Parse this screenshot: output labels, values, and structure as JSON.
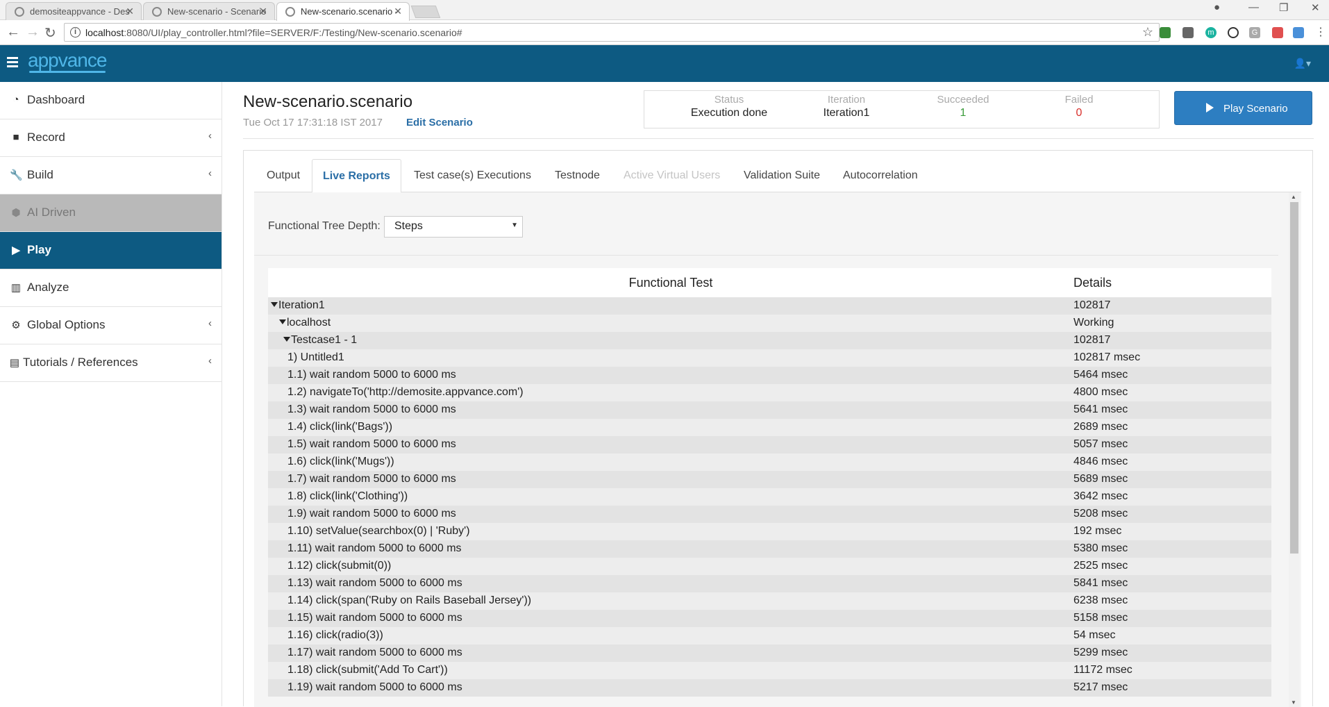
{
  "browser": {
    "tabs": [
      {
        "title": "demositeappvance - Des"
      },
      {
        "title": "New-scenario - Scenario"
      },
      {
        "title": "New-scenario.scenario -"
      }
    ],
    "url_prefix": "localhost",
    "url_rest": ":8080/UI/play_controller.html?file=SERVER/F:/Testing/New-scenario.scenario#"
  },
  "app": {
    "logo": "appvance",
    "brand_color": "#0d5a82"
  },
  "sidebar": {
    "items": [
      {
        "label": "Dashboard",
        "icon": "dashboard-icon"
      },
      {
        "label": "Record",
        "icon": "video-camera-icon"
      },
      {
        "label": "Build",
        "icon": "wrench-icon"
      },
      {
        "label": "AI Driven",
        "icon": "cubes-icon"
      },
      {
        "label": "Play",
        "icon": "play-icon"
      },
      {
        "label": "Analyze",
        "icon": "bar-chart-icon"
      },
      {
        "label": "Global Options",
        "icon": "cogs-icon"
      },
      {
        "label": "Tutorials / References",
        "icon": "book-icon"
      }
    ]
  },
  "header": {
    "title": "New-scenario.scenario",
    "timestamp": "Tue Oct 17 17:31:18 IST 2017",
    "edit_link": "Edit Scenario",
    "status": {
      "status_label": "Status",
      "status_value": "Execution done",
      "iteration_label": "Iteration",
      "iteration_value": "Iteration1",
      "succeeded_label": "Succeeded",
      "succeeded_value": "1",
      "failed_label": "Failed",
      "failed_value": "0"
    },
    "play_button": "Play Scenario"
  },
  "tabs": [
    "Output",
    "Live Reports",
    "Test case(s) Executions",
    "Testnode",
    "Active Virtual Users",
    "Validation Suite",
    "Autocorrelation"
  ],
  "report": {
    "depth_label": "Functional Tree Depth:",
    "depth_value": "Steps",
    "col_test": "Functional Test",
    "col_details": "Details",
    "rows": [
      {
        "label": "Iteration1",
        "detail": "102817"
      },
      {
        "label": "localhost",
        "detail": "Working"
      },
      {
        "label": "Testcase1 - 1",
        "detail": "102817"
      },
      {
        "label": "1) Untitled1",
        "detail": "102817 msec"
      },
      {
        "label": "1.1) wait random 5000 to 6000 ms",
        "detail": "5464 msec"
      },
      {
        "label": "1.2) navigateTo('http://demosite.appvance.com')",
        "detail": "4800 msec"
      },
      {
        "label": "1.3) wait random 5000 to 6000 ms",
        "detail": "5641 msec"
      },
      {
        "label": "1.4) click(link('Bags'))",
        "detail": "2689 msec"
      },
      {
        "label": "1.5) wait random 5000 to 6000 ms",
        "detail": "5057 msec"
      },
      {
        "label": "1.6) click(link('Mugs'))",
        "detail": "4846 msec"
      },
      {
        "label": "1.7) wait random 5000 to 6000 ms",
        "detail": "5689 msec"
      },
      {
        "label": "1.8) click(link('Clothing'))",
        "detail": "3642 msec"
      },
      {
        "label": "1.9) wait random 5000 to 6000 ms",
        "detail": "5208 msec"
      },
      {
        "label": "1.10) setValue(searchbox(0) | 'Ruby')",
        "detail": "192 msec"
      },
      {
        "label": "1.11) wait random 5000 to 6000 ms",
        "detail": "5380 msec"
      },
      {
        "label": "1.12) click(submit(0))",
        "detail": "2525 msec"
      },
      {
        "label": "1.13) wait random 5000 to 6000 ms",
        "detail": "5841 msec"
      },
      {
        "label": "1.14) click(span('Ruby on Rails Baseball Jersey'))",
        "detail": "6238 msec"
      },
      {
        "label": "1.15) wait random 5000 to 6000 ms",
        "detail": "5158 msec"
      },
      {
        "label": "1.16) click(radio(3))",
        "detail": "54 msec"
      },
      {
        "label": "1.17) wait random 5000 to 6000 ms",
        "detail": "5299 msec"
      },
      {
        "label": "1.18) click(submit('Add To Cart'))",
        "detail": "11172 msec"
      },
      {
        "label": "1.19) wait random 5000 to 6000 ms",
        "detail": "5217 msec"
      }
    ]
  }
}
